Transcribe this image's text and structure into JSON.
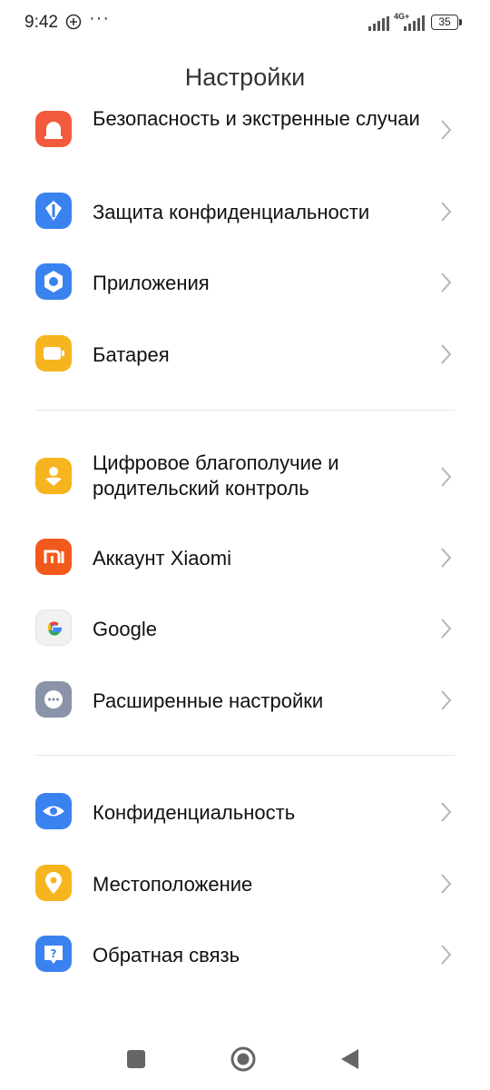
{
  "status_bar": {
    "time": "9:42",
    "more": "···",
    "network": "4G+",
    "battery": "35"
  },
  "page_title": "Настройки",
  "items": [
    {
      "label": "Безопасность и экстренные случаи",
      "icon": "emergency-icon",
      "color": "#f25a3b"
    },
    {
      "label": "Защита конфиденциальности",
      "icon": "privacy-shield-icon",
      "color": "#3a82f0"
    },
    {
      "label": "Приложения",
      "icon": "apps-hexagon-icon",
      "color": "#3a82f0"
    },
    {
      "label": "Батарея",
      "icon": "battery-icon",
      "color": "#f6b51e"
    },
    {
      "label": "Цифровое благополучие и родительский контроль",
      "icon": "wellbeing-icon",
      "color": "#f6b51e"
    },
    {
      "label": "Аккаунт Xiaomi",
      "icon": "xiaomi-mi-icon",
      "color": "#f25a1d"
    },
    {
      "label": "Google",
      "icon": "google-icon",
      "color": "#f1f1f1"
    },
    {
      "label": "Расширенные настройки",
      "icon": "more-dots-icon",
      "color": "#8a93a8"
    },
    {
      "label": "Конфиденциальность",
      "icon": "eye-icon",
      "color": "#3a82f0"
    },
    {
      "label": "Местоположение",
      "icon": "location-pin-icon",
      "color": "#f6b51e"
    },
    {
      "label": "Обратная связь",
      "icon": "feedback-icon",
      "color": "#3a82f0"
    }
  ],
  "nav": {
    "recents": "square-icon",
    "home": "circle-home-icon",
    "back": "back-triangle-icon"
  }
}
